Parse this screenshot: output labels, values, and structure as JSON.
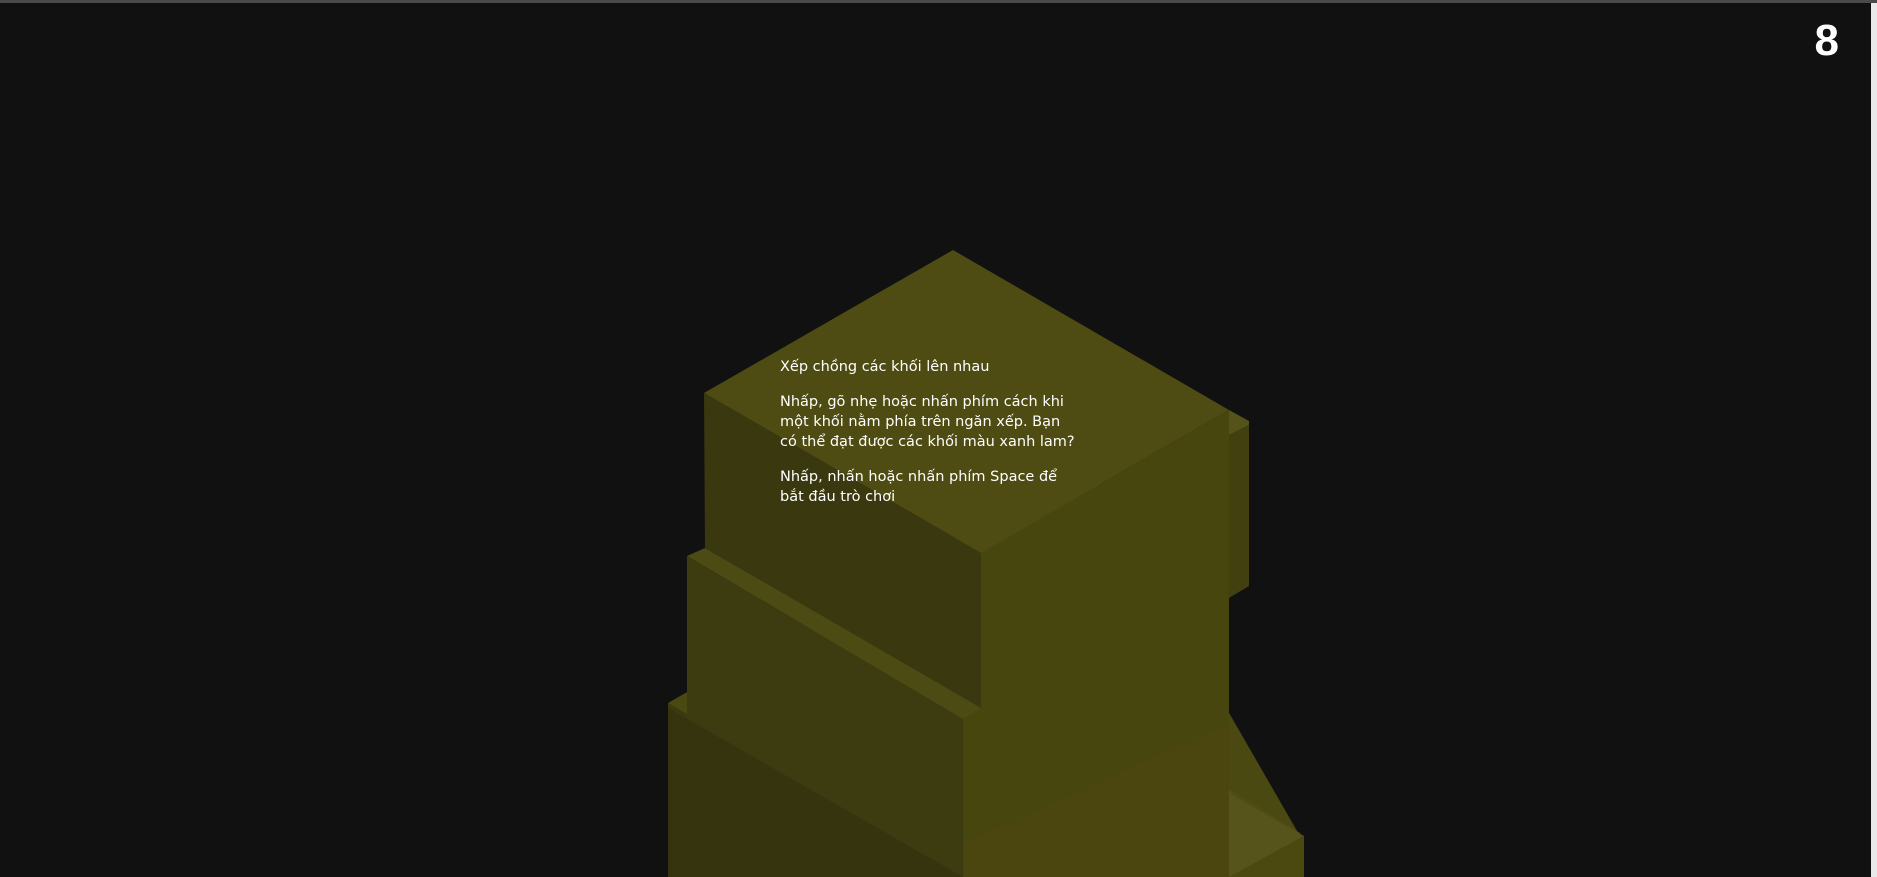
{
  "game": {
    "score": "8",
    "instructions": {
      "title": "Xếp chồng các khối lên nhau",
      "body": "Nhấp, gõ nhẹ hoặc nhấn phím cách khi một khối nằm phía trên ngăn xếp. Bạn có thể đạt được các khối màu xanh lam?",
      "start": "Nhấp, nhấn hoặc nhấn phím Space để bắt đầu trò chơi"
    }
  },
  "colors": {
    "background": "#111111",
    "block_top": "#4f4f14",
    "block_left": "#3a3810",
    "block_right": "#4a4712"
  }
}
